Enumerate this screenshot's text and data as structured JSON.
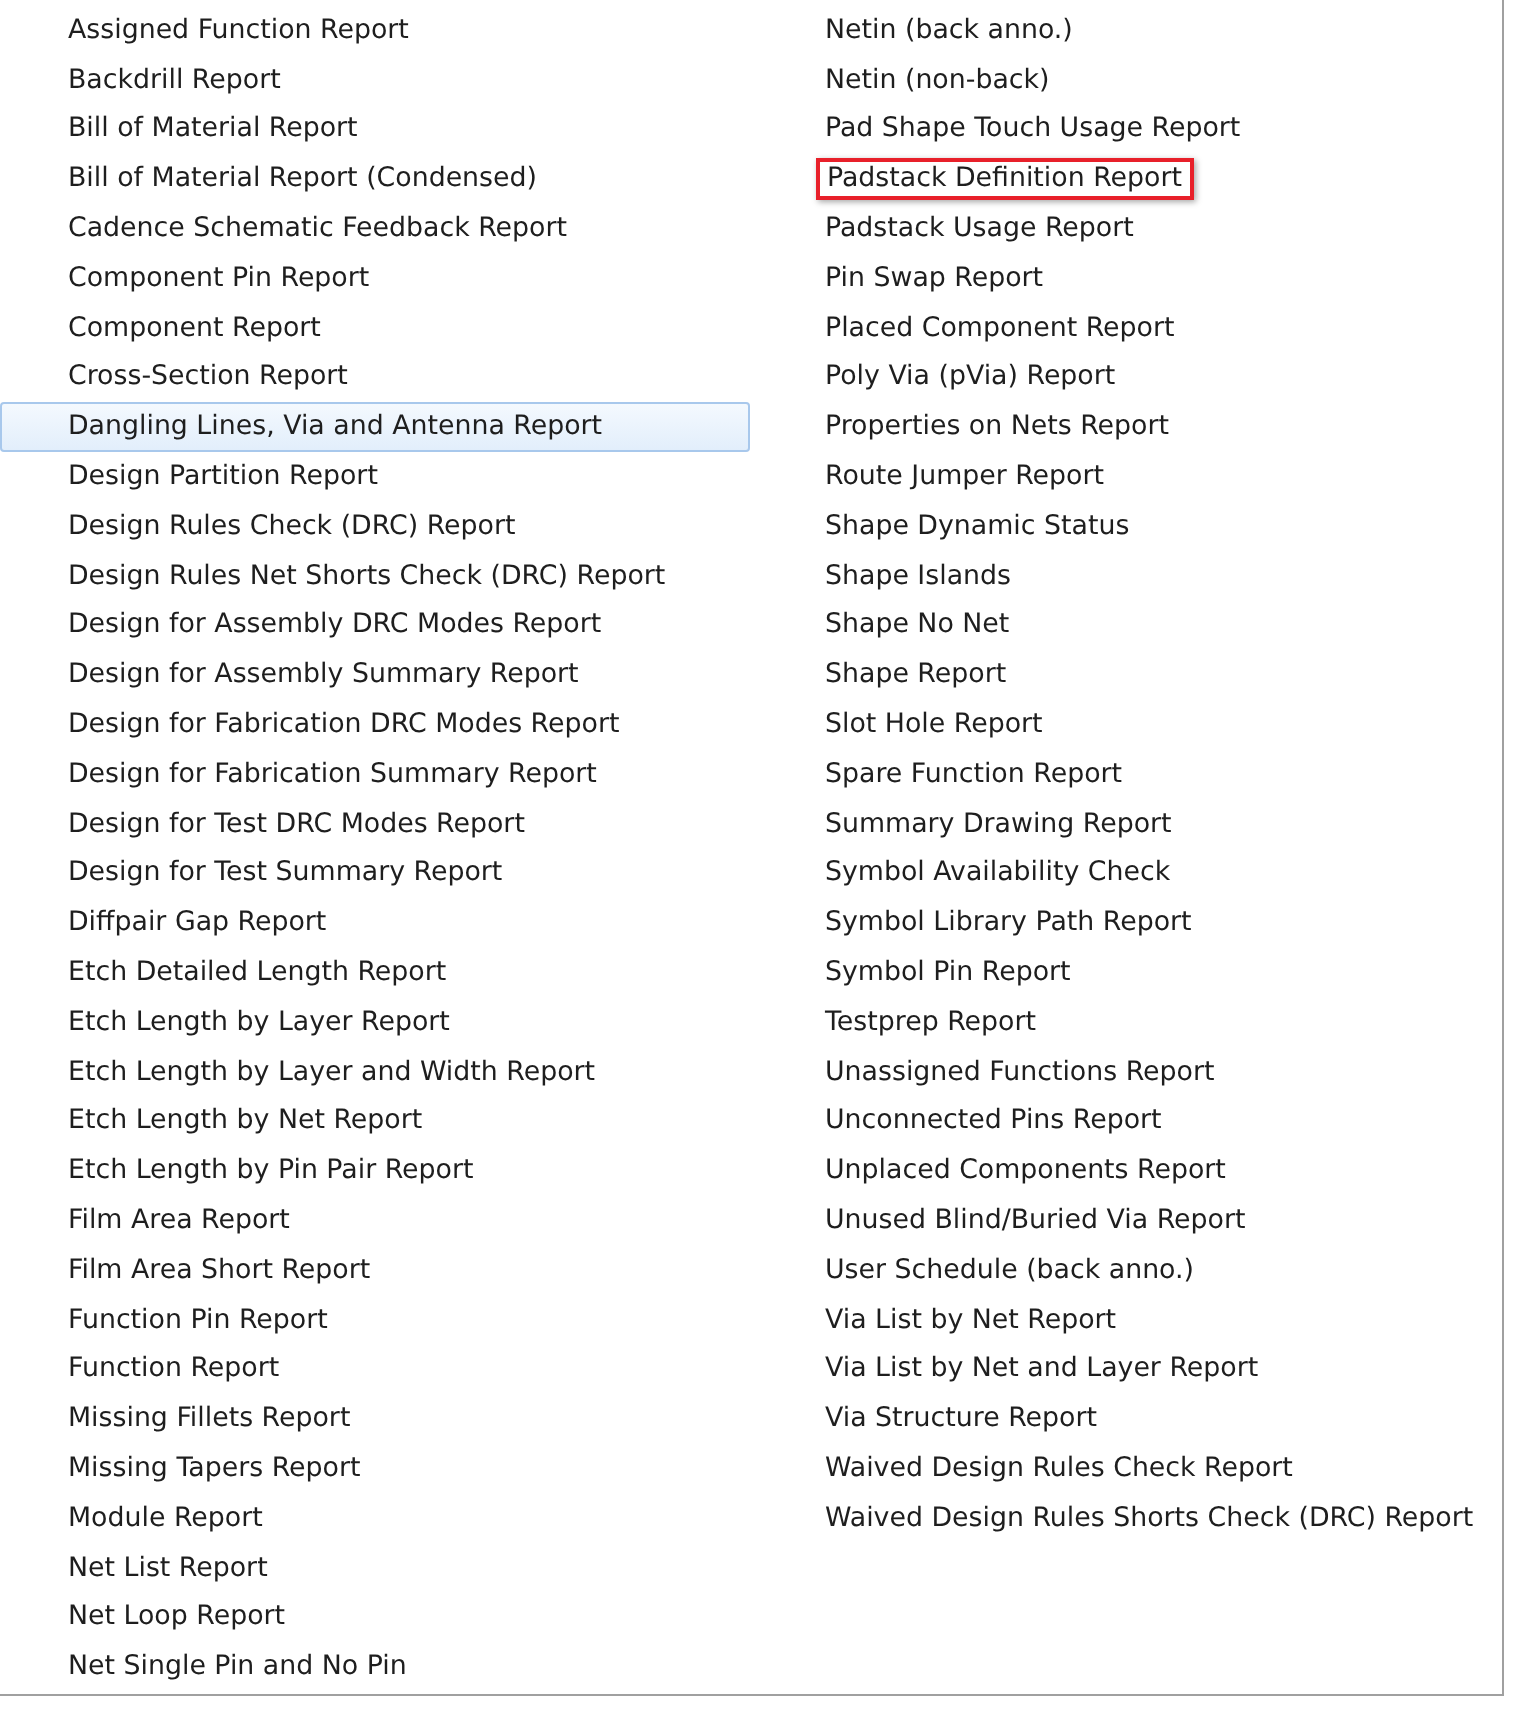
{
  "columns": [
    {
      "items": [
        {
          "label": "Assigned Function Report",
          "selected": false,
          "boxed": false
        },
        {
          "label": "Backdrill Report",
          "selected": false,
          "boxed": false
        },
        {
          "label": "Bill of Material Report",
          "selected": false,
          "boxed": false
        },
        {
          "label": "Bill of Material Report (Condensed)",
          "selected": false,
          "boxed": false
        },
        {
          "label": "Cadence Schematic Feedback Report",
          "selected": false,
          "boxed": false
        },
        {
          "label": "Component Pin Report",
          "selected": false,
          "boxed": false
        },
        {
          "label": "Component Report",
          "selected": false,
          "boxed": false
        },
        {
          "label": "Cross-Section Report",
          "selected": false,
          "boxed": false
        },
        {
          "label": "Dangling Lines, Via and Antenna Report",
          "selected": true,
          "boxed": false
        },
        {
          "label": "Design Partition Report",
          "selected": false,
          "boxed": false
        },
        {
          "label": "Design Rules Check (DRC) Report",
          "selected": false,
          "boxed": false
        },
        {
          "label": "Design Rules Net Shorts Check (DRC) Report",
          "selected": false,
          "boxed": false
        },
        {
          "label": "Design for Assembly DRC Modes Report",
          "selected": false,
          "boxed": false
        },
        {
          "label": "Design for Assembly Summary Report",
          "selected": false,
          "boxed": false
        },
        {
          "label": "Design for Fabrication DRC Modes Report",
          "selected": false,
          "boxed": false
        },
        {
          "label": "Design for Fabrication Summary Report",
          "selected": false,
          "boxed": false
        },
        {
          "label": "Design for Test DRC Modes Report",
          "selected": false,
          "boxed": false
        },
        {
          "label": "Design for Test Summary Report",
          "selected": false,
          "boxed": false
        },
        {
          "label": "Diffpair Gap Report",
          "selected": false,
          "boxed": false
        },
        {
          "label": "Etch Detailed Length Report",
          "selected": false,
          "boxed": false
        },
        {
          "label": "Etch Length by Layer Report",
          "selected": false,
          "boxed": false
        },
        {
          "label": "Etch Length by Layer and Width Report",
          "selected": false,
          "boxed": false
        },
        {
          "label": "Etch Length by Net Report",
          "selected": false,
          "boxed": false
        },
        {
          "label": "Etch Length by Pin Pair Report",
          "selected": false,
          "boxed": false
        },
        {
          "label": "Film Area Report",
          "selected": false,
          "boxed": false
        },
        {
          "label": "Film Area Short Report",
          "selected": false,
          "boxed": false
        },
        {
          "label": "Function Pin Report",
          "selected": false,
          "boxed": false
        },
        {
          "label": "Function Report",
          "selected": false,
          "boxed": false
        },
        {
          "label": "Missing Fillets Report",
          "selected": false,
          "boxed": false
        },
        {
          "label": "Missing Tapers Report",
          "selected": false,
          "boxed": false
        },
        {
          "label": "Module Report",
          "selected": false,
          "boxed": false
        },
        {
          "label": "Net List Report",
          "selected": false,
          "boxed": false
        },
        {
          "label": "Net Loop Report",
          "selected": false,
          "boxed": false
        },
        {
          "label": "Net Single Pin and No Pin",
          "selected": false,
          "boxed": false
        }
      ]
    },
    {
      "items": [
        {
          "label": "Netin (back anno.)",
          "selected": false,
          "boxed": false
        },
        {
          "label": "Netin (non-back)",
          "selected": false,
          "boxed": false
        },
        {
          "label": "Pad Shape Touch Usage Report",
          "selected": false,
          "boxed": false
        },
        {
          "label": "Padstack Definition Report",
          "selected": false,
          "boxed": true
        },
        {
          "label": "Padstack Usage Report",
          "selected": false,
          "boxed": false
        },
        {
          "label": "Pin Swap Report",
          "selected": false,
          "boxed": false
        },
        {
          "label": "Placed Component Report",
          "selected": false,
          "boxed": false
        },
        {
          "label": "Poly Via (pVia) Report",
          "selected": false,
          "boxed": false
        },
        {
          "label": "Properties on Nets Report",
          "selected": false,
          "boxed": false
        },
        {
          "label": "Route Jumper Report",
          "selected": false,
          "boxed": false
        },
        {
          "label": "Shape Dynamic Status",
          "selected": false,
          "boxed": false
        },
        {
          "label": "Shape Islands",
          "selected": false,
          "boxed": false
        },
        {
          "label": "Shape No Net",
          "selected": false,
          "boxed": false
        },
        {
          "label": "Shape Report",
          "selected": false,
          "boxed": false
        },
        {
          "label": "Slot Hole Report",
          "selected": false,
          "boxed": false
        },
        {
          "label": "Spare Function Report",
          "selected": false,
          "boxed": false
        },
        {
          "label": "Summary Drawing Report",
          "selected": false,
          "boxed": false
        },
        {
          "label": "Symbol Availability Check",
          "selected": false,
          "boxed": false
        },
        {
          "label": "Symbol Library Path Report",
          "selected": false,
          "boxed": false
        },
        {
          "label": "Symbol Pin Report",
          "selected": false,
          "boxed": false
        },
        {
          "label": "Testprep Report",
          "selected": false,
          "boxed": false
        },
        {
          "label": "Unassigned Functions Report",
          "selected": false,
          "boxed": false
        },
        {
          "label": "Unconnected Pins Report",
          "selected": false,
          "boxed": false
        },
        {
          "label": "Unplaced Components Report",
          "selected": false,
          "boxed": false
        },
        {
          "label": "Unused Blind/Buried Via Report",
          "selected": false,
          "boxed": false
        },
        {
          "label": "User Schedule (back anno.)",
          "selected": false,
          "boxed": false
        },
        {
          "label": "Via List by Net Report",
          "selected": false,
          "boxed": false
        },
        {
          "label": "Via List by Net and Layer Report",
          "selected": false,
          "boxed": false
        },
        {
          "label": "Via Structure Report",
          "selected": false,
          "boxed": false
        },
        {
          "label": "Waived Design Rules Check Report",
          "selected": false,
          "boxed": false
        },
        {
          "label": "Waived Design Rules Shorts Check (DRC) Report",
          "selected": false,
          "boxed": false
        }
      ]
    }
  ]
}
